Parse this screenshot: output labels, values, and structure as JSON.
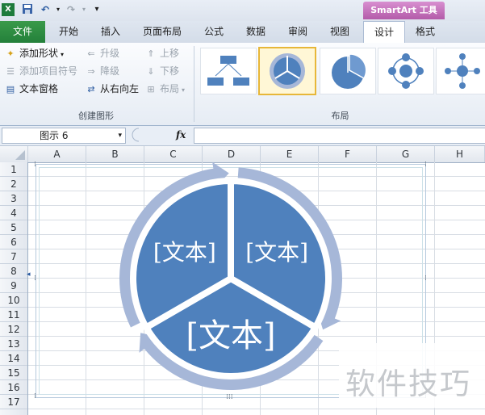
{
  "titlebar": {
    "smartart_tools": "SmartArt 工具"
  },
  "tabs": {
    "file": "文件",
    "home": "开始",
    "insert": "插入",
    "page_layout": "页面布局",
    "formulas": "公式",
    "data": "数据",
    "review": "审阅",
    "view": "视图",
    "design": "设计",
    "format": "格式"
  },
  "ribbon": {
    "create_graphic": {
      "add_shape": "添加形状",
      "add_bullet": "添加项目符号",
      "text_pane": "文本窗格",
      "promote": "升级",
      "demote": "降级",
      "right_to_left": "从右向左",
      "move_up": "上移",
      "move_down": "下移",
      "layout": "布局",
      "group_label": "创建图形"
    },
    "layouts": {
      "group_label": "布局"
    }
  },
  "formula_bar": {
    "name_box": "图示 6",
    "fx": "fx",
    "value": ""
  },
  "columns": [
    "A",
    "B",
    "C",
    "D",
    "E",
    "F",
    "G",
    "H"
  ],
  "rows": [
    "1",
    "2",
    "3",
    "4",
    "5",
    "6",
    "7",
    "8",
    "9",
    "10",
    "11",
    "12",
    "13",
    "14",
    "15",
    "16",
    "17"
  ],
  "smartart": {
    "segments": [
      "[文本]",
      "[文本]",
      "[文本]"
    ],
    "colors": {
      "fill": "#4f81bd",
      "ring": "#a6b7d8"
    }
  },
  "watermark": "软件技巧"
}
